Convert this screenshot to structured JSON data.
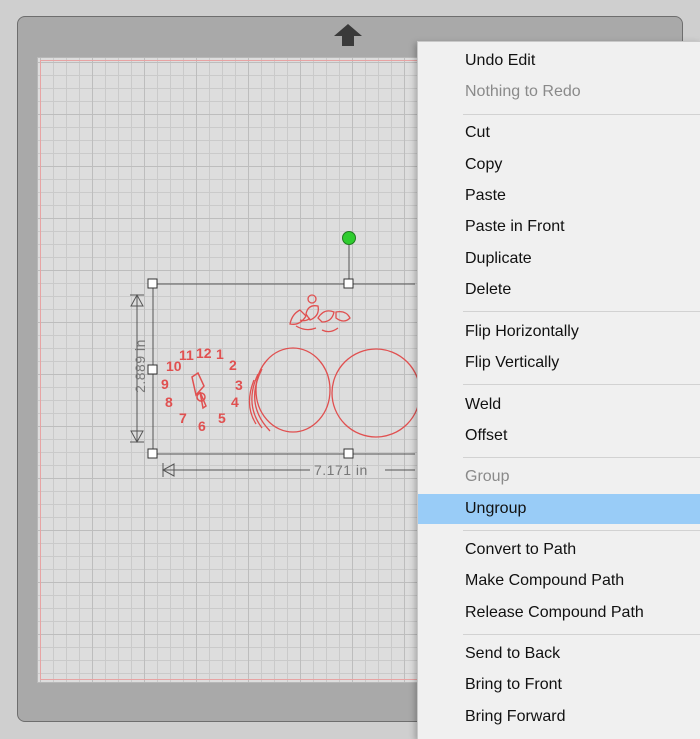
{
  "canvas": {
    "dimensions": {
      "width_label": "7.171 in",
      "height_label": "2.889 in"
    },
    "design_digits": [
      "12",
      "1",
      "2",
      "3",
      "4",
      "5",
      "6",
      "7",
      "8",
      "9",
      "10",
      "11"
    ]
  },
  "context_menu": {
    "items": [
      {
        "label": "Undo Edit",
        "enabled": true
      },
      {
        "label": "Nothing to Redo",
        "enabled": false
      },
      {
        "label": "Cut",
        "enabled": true
      },
      {
        "label": "Copy",
        "enabled": true
      },
      {
        "label": "Paste",
        "enabled": true
      },
      {
        "label": "Paste in Front",
        "enabled": true
      },
      {
        "label": "Duplicate",
        "enabled": true
      },
      {
        "label": "Delete",
        "enabled": true
      },
      {
        "label": "Flip Horizontally",
        "enabled": true
      },
      {
        "label": "Flip Vertically",
        "enabled": true
      },
      {
        "label": "Weld",
        "enabled": true
      },
      {
        "label": "Offset",
        "enabled": true
      },
      {
        "label": "Group",
        "enabled": false
      },
      {
        "label": "Ungroup",
        "enabled": true,
        "highlighted": true
      },
      {
        "label": "Convert to Path",
        "enabled": true
      },
      {
        "label": "Make Compound Path",
        "enabled": true
      },
      {
        "label": "Release Compound Path",
        "enabled": true
      },
      {
        "label": "Send to Back",
        "enabled": true
      },
      {
        "label": "Bring to Front",
        "enabled": true
      },
      {
        "label": "Bring Forward",
        "enabled": true
      }
    ]
  },
  "colors": {
    "design_stroke": "#e05050",
    "highlight": "#99ccf7",
    "rotate_handle": "#2ecc2e"
  },
  "icons": {
    "mat_up_arrow": "arrow-up-icon",
    "rotate_handle": "rotate-handle-icon"
  }
}
